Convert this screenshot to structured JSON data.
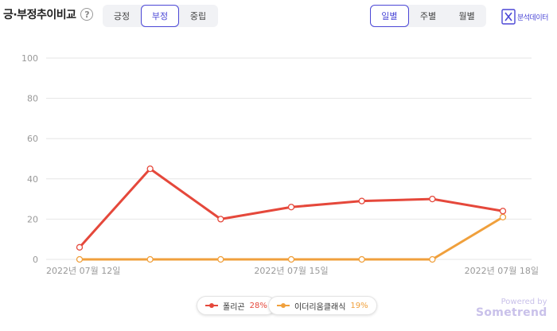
{
  "header": {
    "title": "긍·부정추이비교",
    "help_glyph": "?"
  },
  "sentiment_tabs": [
    {
      "label": "긍정",
      "active": false
    },
    {
      "label": "부정",
      "active": true
    },
    {
      "label": "중립",
      "active": false
    }
  ],
  "period_tabs": [
    {
      "label": "일별",
      "active": true
    },
    {
      "label": "주별",
      "active": false
    },
    {
      "label": "월별",
      "active": false
    }
  ],
  "export": {
    "label": "분석데이터",
    "icon": "excel-icon"
  },
  "legend": [
    {
      "name": "폴리곤",
      "percent": "28%",
      "color": "#e5483b"
    },
    {
      "name": "이더리움클래식",
      "percent": "19%",
      "color": "#f0a03c"
    }
  ],
  "branding": {
    "powered_by": "Powered by",
    "brand": "Sometrend"
  },
  "chart_data": {
    "type": "line",
    "y_ticks": [
      "100",
      "80",
      "60",
      "40",
      "20",
      "0"
    ],
    "ylim": [
      0,
      100
    ],
    "x_tick_labels": [
      "2022년 07월 12일",
      "2022년 07월 15일",
      "2022년 07월 18일"
    ],
    "x_count": 7,
    "x_tick_indices": [
      0,
      3,
      6
    ],
    "grid": true,
    "series": [
      {
        "name": "폴리곤",
        "color": "#e5483b",
        "values": [
          6,
          45,
          20,
          26,
          29,
          30,
          24
        ]
      },
      {
        "name": "이더리움클래식",
        "color": "#f0a03c",
        "values": [
          0,
          0,
          0,
          0,
          0,
          0,
          21
        ]
      }
    ]
  }
}
